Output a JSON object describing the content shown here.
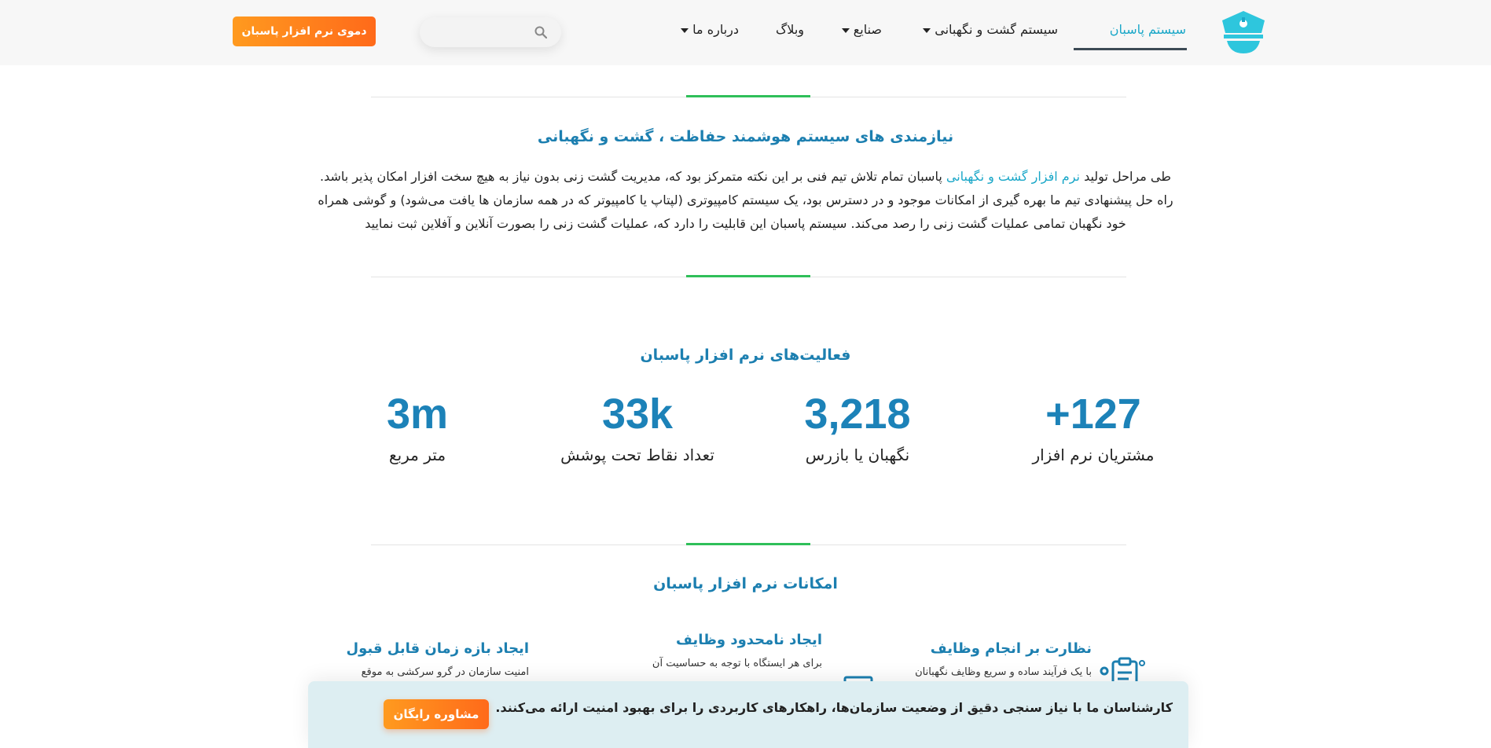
{
  "header": {
    "nav": [
      {
        "label": "سیستم پاسبان",
        "active": true,
        "has_dropdown": false
      },
      {
        "label": "سیستم گشت و نگهبانی",
        "active": false,
        "has_dropdown": true
      },
      {
        "label": "صنایع",
        "active": false,
        "has_dropdown": true
      },
      {
        "label": "وبلاگ",
        "active": false,
        "has_dropdown": false
      },
      {
        "label": "درباره ما",
        "active": false,
        "has_dropdown": true
      }
    ],
    "search": {
      "placeholder": "",
      "icon": "search-icon"
    },
    "demo_button": "دموی نرم افزار پاسبان",
    "logo_icon": "police-cap-icon"
  },
  "intro": {
    "title": "نیازمندی های سیستم هوشمند حفاظت ، گشت و نگهبانی",
    "text_before_link": "طی مراحل تولید",
    "link": "نرم افزار گشت و نگهبانی",
    "text_after_link": "پاسبان تمام تلاش تیم فنی بر این نکته متمرکز بود که، مدیریت گشت زنی بدون نیاز به هیچ سخت افزار امکان پذیر باشد. راه حل پیشنهادی تیم ما بهره گیری از امکانات موجود و در دسترس بود، یک سیستم کامپیوتری (لپتاپ یا کامپیوتر که در همه سازمان ها یافت می‌شود) و گوشی همراه خود نگهبان تمامی عملیات گشت زنی را رصد می‌کند. سیستم پاسبان این قابلیت را دارد که، عملیات گشت زنی را بصورت آنلاین و آفلاین ثبت نمایید"
  },
  "stats": {
    "title": "فعالیت‌های نرم افزار پاسبان",
    "items": [
      {
        "value": "+127",
        "label": "مشتریان نرم افزار"
      },
      {
        "value": "3,218",
        "label": "نگهبان یا بازرس"
      },
      {
        "value": "33k",
        "label": "تعداد نقاط تحت پوشش"
      },
      {
        "value": "3m",
        "label": "متر مربع"
      }
    ]
  },
  "features": {
    "title": "امکانات نرم افزار پاسبان",
    "items": [
      {
        "title": "نظارت بر انجام وظایف",
        "desc": "با یک فرآیند ساده و سریع وظایف نگهبانان",
        "icon": "clipboard-check-icon"
      },
      {
        "title": "ایجاد نامحدود وظایف",
        "desc": "برای هر ایستگاه با توجه به حساسیت آن",
        "icon": "task-list-icon"
      },
      {
        "title": "ایجاد بازه زمان قابل قبول",
        "desc": "امنیت سازمان در گرو سرکشی به موقع",
        "icon": ""
      }
    ]
  },
  "cta": {
    "text": "کارشناسان ما با نیاز سنجی دقیق از وضعیت سازمان‌ها، راهکارهای کاربردی را برای بهبود امنیت ارائه می‌کنند.",
    "button": "مشاوره رایگان"
  },
  "colors": {
    "accent": "#1c7fb0",
    "link": "#1aa7c8",
    "orange": "#ff7a1a",
    "divider_accent": "#2fbf59",
    "cta_bg": "#ddeef2"
  }
}
